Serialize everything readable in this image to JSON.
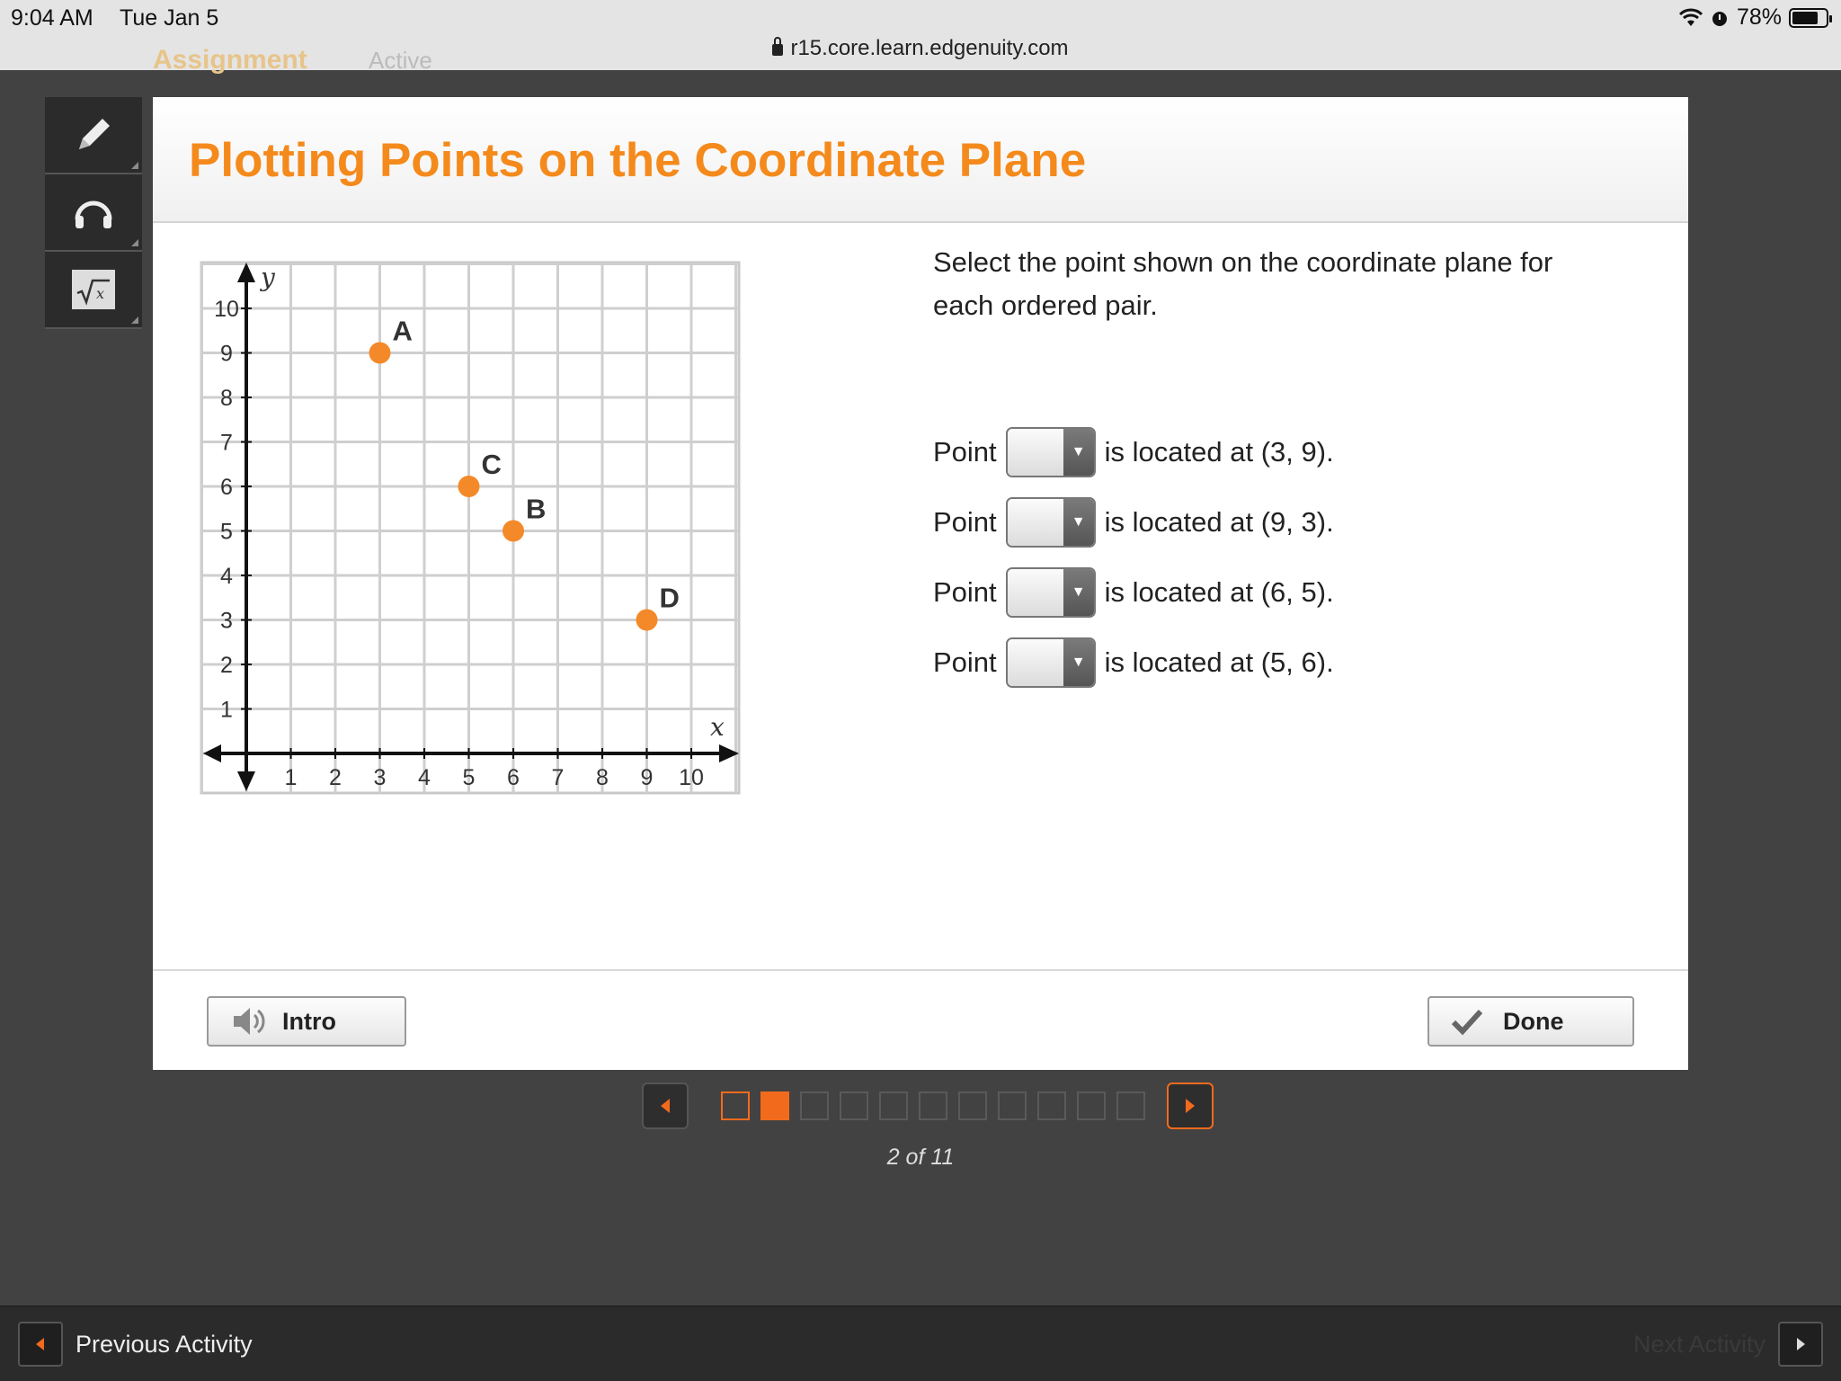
{
  "status_bar": {
    "time": "9:04 AM",
    "date": "Tue Jan 5",
    "battery": "78%",
    "battery_level": 0.78,
    "url": "r15.core.learn.edgenuity.com"
  },
  "behind_nav": {
    "left": "Assignment",
    "right": "Active"
  },
  "tools": [
    {
      "icon": "pencil-icon"
    },
    {
      "icon": "headphones-icon"
    },
    {
      "icon": "square-root-icon"
    }
  ],
  "lesson": {
    "title": "Plotting Points on the Coordinate Plane",
    "prompt": "Select the point shown on the coordinate plane for each ordered pair.",
    "rows": [
      {
        "prefix": "Point",
        "suffix": "is located at (3, 9)."
      },
      {
        "prefix": "Point",
        "suffix": "is located at (9, 3)."
      },
      {
        "prefix": "Point",
        "suffix": "is located at (6, 5)."
      },
      {
        "prefix": "Point",
        "suffix": "is located at (5, 6)."
      }
    ],
    "intro_label": "Intro",
    "done_label": "Done"
  },
  "chart_data": {
    "type": "scatter",
    "xlabel": "x",
    "ylabel": "y",
    "xlim": [
      0,
      10
    ],
    "ylim": [
      0,
      10
    ],
    "x_ticks": [
      "1",
      "2",
      "3",
      "4",
      "5",
      "6",
      "7",
      "8",
      "9",
      "10"
    ],
    "y_ticks": [
      "1",
      "2",
      "3",
      "4",
      "5",
      "6",
      "7",
      "8",
      "9",
      "10"
    ],
    "grid": true,
    "point_color": "#f4892a",
    "points": [
      {
        "label": "A",
        "x": 3,
        "y": 9
      },
      {
        "label": "C",
        "x": 5,
        "y": 6
      },
      {
        "label": "B",
        "x": 6,
        "y": 5
      },
      {
        "label": "D",
        "x": 9,
        "y": 3
      }
    ]
  },
  "pager": {
    "total": 11,
    "current": 2,
    "count_text": "2 of 11"
  },
  "activity_bar": {
    "prev_label": "Previous Activity",
    "next_label": "Next Activity"
  },
  "colors": {
    "accent": "#f48a1c",
    "pager_active": "#f26b1d"
  }
}
